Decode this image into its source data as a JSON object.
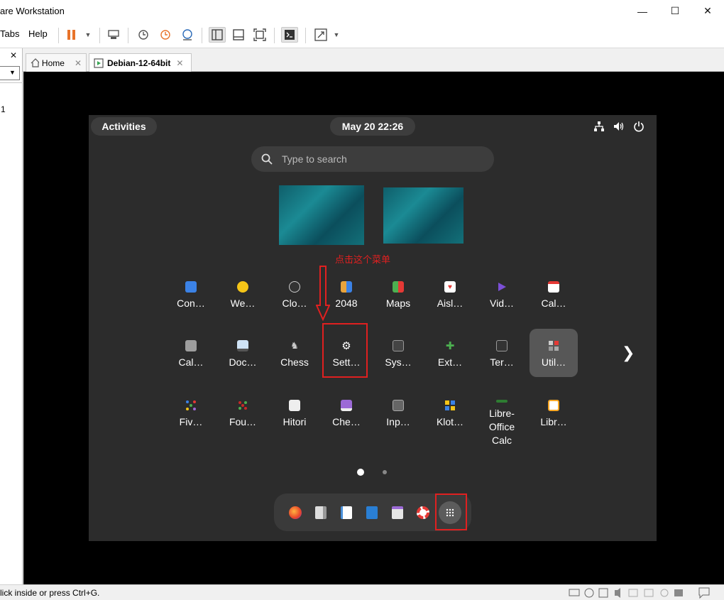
{
  "window": {
    "title": "are Workstation",
    "minimize": "—",
    "maximize": "☐",
    "close": "✕"
  },
  "menu": {
    "tabs": "Tabs",
    "help": "Help"
  },
  "library": {
    "close": "✕",
    "dropdown": "▼",
    "row_text": "1"
  },
  "tabs": [
    {
      "label": "Home",
      "close": "✕"
    },
    {
      "label": "Debian-12-64bit",
      "close": "✕"
    }
  ],
  "guest": {
    "activities": "Activities",
    "clock": "May 20  22:26",
    "search_placeholder": "Type to search",
    "annotation": "点击这个菜单",
    "next_page": "❯",
    "apps_row1": [
      {
        "label": "Con…",
        "icon": "contacts-icon",
        "color": "#3b82e6"
      },
      {
        "label": "We…",
        "icon": "weather-icon",
        "color": "#f5c518"
      },
      {
        "label": "Clo…",
        "icon": "clocks-icon",
        "color": "#555555"
      },
      {
        "label": "2048",
        "icon": "2048-icon",
        "color": "#e8a33c"
      },
      {
        "label": "Maps",
        "icon": "maps-icon",
        "color": "#4caf50"
      },
      {
        "label": "Aisl…",
        "icon": "aisleriot-icon",
        "color": "#e53935"
      },
      {
        "label": "Vid…",
        "icon": "videos-icon",
        "color": "#7b4fd6"
      },
      {
        "label": "Cal…",
        "icon": "calendar-icon",
        "color": "#ffffff"
      }
    ],
    "apps_row2": [
      {
        "label": "Cal…",
        "icon": "calculator-icon",
        "color": "#9e9e9e"
      },
      {
        "label": "Doc…",
        "icon": "document-scanner-icon",
        "color": "#6fa8dc"
      },
      {
        "label": "Chess",
        "icon": "chess-icon",
        "color": "#bbbbbb"
      },
      {
        "label": "Sett…",
        "icon": "settings-gear-icon",
        "color": "#ffffff"
      },
      {
        "label": "Sys…",
        "icon": "system-monitor-icon",
        "color": "#666666"
      },
      {
        "label": "Ext…",
        "icon": "extensions-icon",
        "color": "#4caf50"
      },
      {
        "label": "Ter…",
        "icon": "terminal-icon",
        "color": "#555555"
      },
      {
        "label": "Util…",
        "icon": "utilities-folder-icon",
        "color": "#888888"
      }
    ],
    "apps_row3": [
      {
        "label": "Fiv…",
        "icon": "five-or-more-icon",
        "color": "#3b82e6"
      },
      {
        "label": "Fou…",
        "icon": "four-in-a-row-icon",
        "color": "#c62828"
      },
      {
        "label": "Hitori",
        "icon": "hitori-icon",
        "color": "#eeeeee"
      },
      {
        "label": "Che…",
        "icon": "cheese-icon",
        "color": "#9c6ad6"
      },
      {
        "label": "Inp…",
        "icon": "input-method-icon",
        "color": "#777777"
      },
      {
        "label": "Klot…",
        "icon": "klotski-icon",
        "color": "#f5c518"
      },
      {
        "label": "Libre-Office Calc",
        "icon": "libreoffice-calc-icon",
        "color": "#2e7d32"
      },
      {
        "label": "Libr…",
        "icon": "libreoffice-draw-icon",
        "color": "#f9a825"
      }
    ],
    "dock": [
      {
        "name": "firefox-icon",
        "color": "#ff7139"
      },
      {
        "name": "files-icon",
        "color": "#cfcfcf"
      },
      {
        "name": "text-editor-icon",
        "color": "#4a90d9"
      },
      {
        "name": "libreoffice-writer-icon",
        "color": "#2a7fd4"
      },
      {
        "name": "software-icon",
        "color": "#e6e6e6"
      },
      {
        "name": "help-icon",
        "color": "#e53935"
      }
    ],
    "app_grid_icon": "⋮⋮⋮"
  },
  "status": {
    "text": "lick inside or press Ctrl+G."
  },
  "colors": {
    "highlight_red": "#e02020",
    "annotation_red": "#e02020",
    "shell_bg": "#2c2c2c",
    "pill_bg": "#3d3d3d"
  }
}
